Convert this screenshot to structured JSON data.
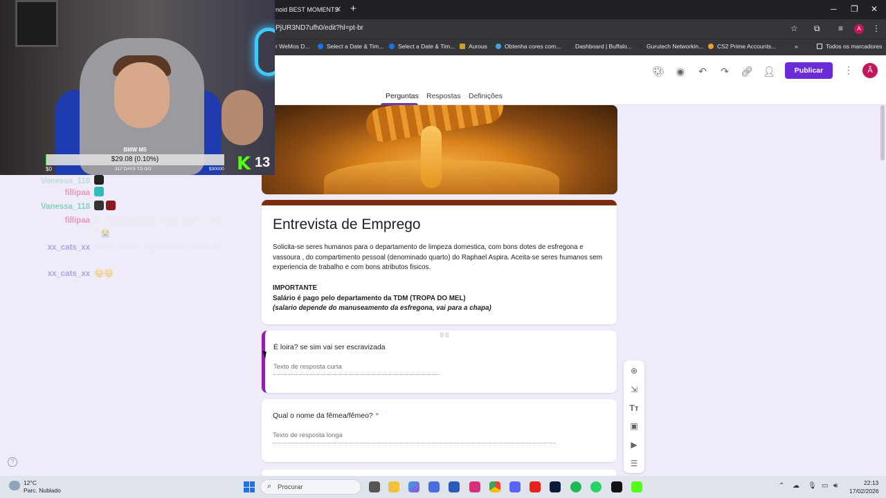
{
  "browser": {
    "tab_title": "noid BEST MOMENTS",
    "url": "PjUR3ND7ufh0/edit?hl=pt-br",
    "bookmarks": [
      {
        "label": "r WeMos D...",
        "color": "#888888"
      },
      {
        "label": "Select a Date & Tim...",
        "color": "#1a73e8"
      },
      {
        "label": "Select a Date & Tim...",
        "color": "#1a73e8"
      },
      {
        "label": "Aurous",
        "color": "#c9a227"
      },
      {
        "label": "Obtenha cores com...",
        "color": "#4aa3df"
      },
      {
        "label": "Dashboard | Buffalo...",
        "color": "#333333"
      },
      {
        "label": "Gurutech Networkin...",
        "color": "#333333"
      },
      {
        "label": "CS2 Prime Accounts...",
        "color": "#e8a02a"
      }
    ],
    "all_bookmarks": "Todos os marcadores",
    "profile_initial": "A"
  },
  "forms": {
    "publish_label": "Publicar",
    "avatar_initial": "Ã",
    "tabs": [
      "Perguntas",
      "Respostas",
      "Definições"
    ],
    "accent": "#673ab7",
    "title": "Entrevista de Emprego",
    "description": "Solicita-se seres humanos para o departamento de limpeza domestica, com bons dotes de esfregona e vassoura , do compartimento pessoal (denominado quarto) do Raphael Aspira. Aceita-se seres humanos sem experiencia de trabalho e com bons atributos fisicos.",
    "important_heading": "IMPORTANTE",
    "important_line1": "Salário é pago pelo departamento da TDM (TROPA DO MEL)",
    "important_line2": "(salario depende do manuseamento da esfregona, vai para a chapa)",
    "questions": [
      {
        "title": "É loira? se sim vai ser escravizada",
        "required": false,
        "placeholder": "Texto de resposta curta"
      },
      {
        "title": "Qual o nome da fêmea/fêmeo?",
        "required": true,
        "placeholder": "Texto de resposta longa"
      }
    ],
    "required_mark": "*"
  },
  "stream": {
    "goal_label": "BMW M5",
    "goal_value": "$29.08 (0.10%)",
    "goal_progress": 0.001,
    "goal_min": "$0",
    "goal_days": "317 DAYS TO GO",
    "goal_max": "$30000",
    "kick_count": "13",
    "chat": [
      {
        "name": "Vanessa_118",
        "color": "#7ad0b4",
        "msg": ""
      },
      {
        "name": "fillipaa",
        "color": "#e58fb0",
        "msg": ""
      },
      {
        "name": "Vanessa_118",
        "color": "#7ad0b4",
        "msg": ""
      },
      {
        "name": "fillipaa",
        "color": "#e58fb0",
        "msg": "eu pessoalmente nunca medi o meu ff 😭"
      },
      {
        "name": "xx_cats_xx",
        "color": "#a29be8",
        "msg": "toda a gente com martelo menos eu"
      },
      {
        "name": "xx_cats_xx",
        "color": "#a29be8",
        "msg": "😔😔"
      }
    ]
  },
  "taskbar": {
    "weather_temp": "12°C",
    "weather_cond": "Parc. Nublado",
    "search_placeholder": "Procurar",
    "time": "22:13",
    "date": "17/02/2026"
  }
}
